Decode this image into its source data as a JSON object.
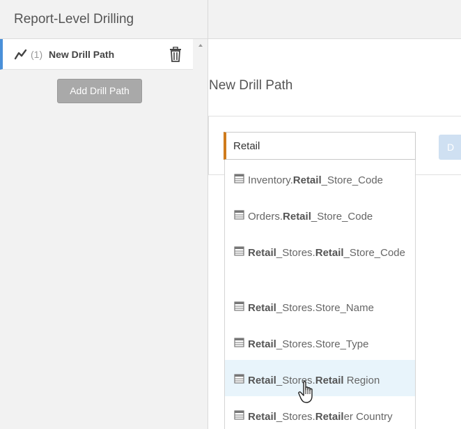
{
  "sidebar": {
    "title": "Report-Level Drilling",
    "drill_paths": [
      {
        "index": "(1)",
        "name": "New Drill Path"
      }
    ],
    "add_button": "Add Drill Path"
  },
  "main": {
    "title": "New Drill Path",
    "search": {
      "value": "Retail"
    },
    "partial_button": "D"
  },
  "dropdown": {
    "options": [
      {
        "prefix": "Inventory.",
        "m1": "Retail",
        "mid": "_Store_Code",
        "m2": "",
        "suffix": ""
      },
      {
        "prefix": "Orders.",
        "m1": "Retail",
        "mid": "_Store_Code",
        "m2": "",
        "suffix": ""
      },
      {
        "prefix": "",
        "m1": "Retail",
        "mid": "_Stores.",
        "m2": "Retail",
        "suffix": "_Store_Code"
      },
      {
        "prefix": "",
        "m1": "Retail",
        "mid": "_Stores.Store_Name",
        "m2": "",
        "suffix": ""
      },
      {
        "prefix": "",
        "m1": "Retail",
        "mid": "_Stores.Store_Type",
        "m2": "",
        "suffix": ""
      },
      {
        "prefix": "",
        "m1": "Retail",
        "mid": "_Stores.",
        "m2": "Retail",
        "suffix": " Region"
      },
      {
        "prefix": "",
        "m1": "Retail",
        "mid": "_Stores.",
        "m2": "Retail",
        "suffix": "er Country"
      }
    ],
    "highlighted_index": 5
  },
  "colors": {
    "accent_blue": "#4a90d9",
    "input_accent": "#cf7b1c",
    "highlight_bg": "#e8f4fb",
    "button_gray": "#a9a9a9"
  },
  "icons": {
    "trend": "trend-line-icon",
    "delete": "trash-icon",
    "field": "database-table-icon",
    "pointer": "hand-pointer-cursor-icon"
  }
}
